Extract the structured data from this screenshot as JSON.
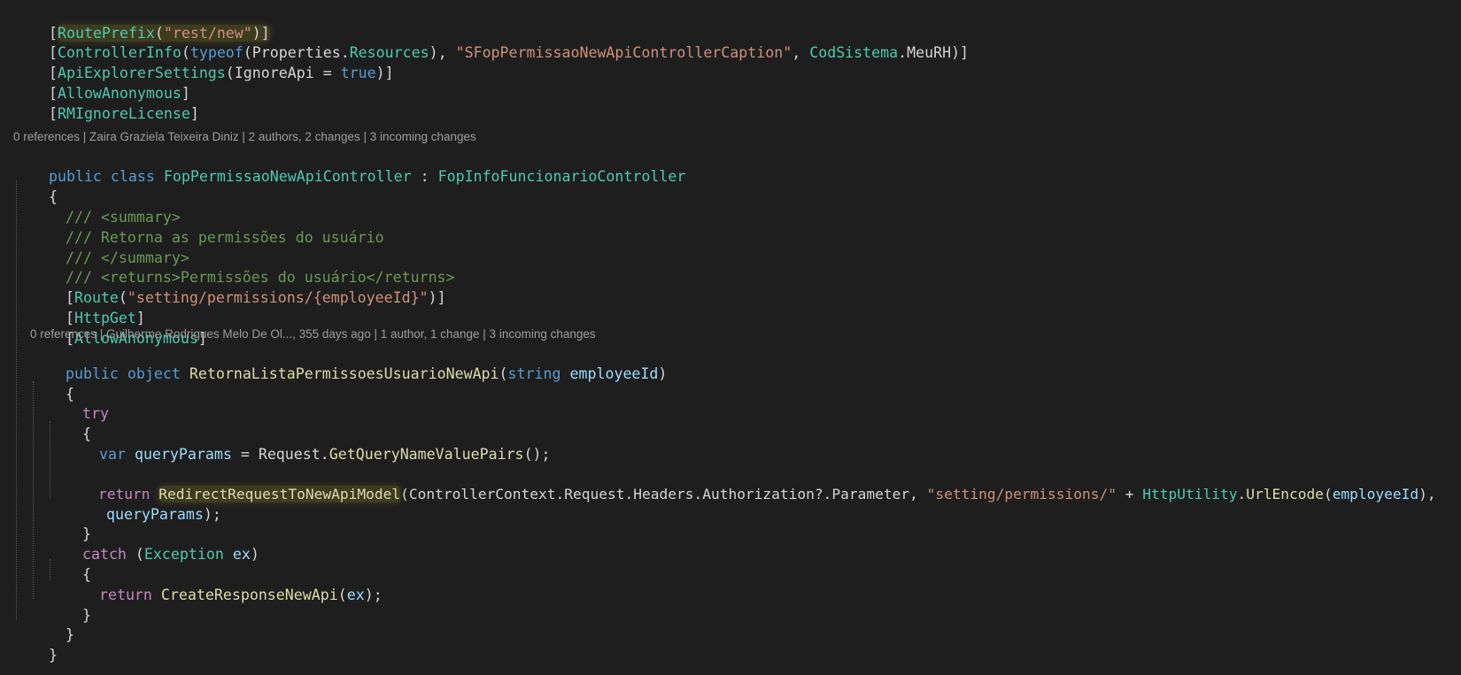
{
  "code": {
    "l1": {
      "a": "[",
      "b": "RoutePrefix",
      "c": "(",
      "d": "\"rest/new\"",
      "e": ")]"
    },
    "l2": {
      "a": "[",
      "b": "ControllerInfo",
      "c": "(",
      "d": "typeof",
      "e": "(Properties.",
      "f": "Resources",
      "g": "), ",
      "h": "\"SFopPermissaoNewApiControllerCaption\"",
      "i": ", ",
      "j": "CodSistema",
      "k": ".MeuRH)]"
    },
    "l3": {
      "a": "[",
      "b": "ApiExplorerSettings",
      "c": "(IgnoreApi = ",
      "d": "true",
      "e": ")]"
    },
    "l4": {
      "a": "[",
      "b": "AllowAnonymous",
      "c": "]"
    },
    "l5": {
      "a": "[",
      "b": "RMIgnoreLicense",
      "c": "]"
    },
    "l6": {
      "a": "public",
      "b": " ",
      "c": "class",
      "d": " ",
      "e": "FopPermissaoNewApiController",
      "f": " : ",
      "g": "FopInfoFuncionarioController"
    },
    "l7": {
      "a": "{"
    },
    "l8": {
      "a": "/// <summary>"
    },
    "l9": {
      "a": "/// Retorna as permissões do usuário"
    },
    "l10": {
      "a": "/// </summary>"
    },
    "l11": {
      "a": "/// <returns>Permissões do usuário</returns>"
    },
    "l12": {
      "a": "[",
      "b": "Route",
      "c": "(",
      "d": "\"setting/permissions/{employeeId}\"",
      "e": ")]"
    },
    "l13": {
      "a": "[",
      "b": "HttpGet",
      "c": "]"
    },
    "l14": {
      "a": "[",
      "b": "AllowAnonymous",
      "c": "]"
    },
    "l15": {
      "a": "public",
      "b": " ",
      "c": "object",
      "d": " ",
      "e": "RetornaListaPermissoesUsuarioNewApi",
      "f": "(",
      "g": "string",
      "h": " ",
      "i": "employeeId",
      "j": ")"
    },
    "l16": {
      "a": "{"
    },
    "l17": {
      "a": "try"
    },
    "l18": {
      "a": "{"
    },
    "l19": {
      "a": "var",
      "b": " ",
      "c": "queryParams",
      "d": " = Request.",
      "e": "GetQueryNameValuePairs",
      "f": "();"
    },
    "l20": {
      "a": "return",
      "b": " ",
      "c": "RedirectRequestToNewApiModel",
      "d": "(ControllerContext.Request.Headers.Authorization?.Parameter, ",
      "e": "\"setting/permissions/\"",
      "f": " + ",
      "g": "HttpUtility",
      "h": ".",
      "i": "UrlEncode",
      "j": "(",
      "k": "employeeId",
      "l": "),"
    },
    "l21": {
      "a": "queryParams",
      "b": ");"
    },
    "l22": {
      "a": "}"
    },
    "l23": {
      "a": "catch",
      "b": " (",
      "c": "Exception",
      "d": " ",
      "e": "ex",
      "f": ")"
    },
    "l24": {
      "a": "{"
    },
    "l25": {
      "a": "return",
      "b": " ",
      "c": "CreateResponseNewApi",
      "d": "(",
      "e": "ex",
      "f": ");"
    },
    "l26": {
      "a": "}"
    },
    "l27": {
      "a": "}"
    },
    "l28": {
      "a": "}"
    }
  },
  "codelens": {
    "class_lens": "0 references | Zaira Graziela Teixeira Diniz | 2 authors, 2 changes | 3 incoming changes",
    "method_lens": "0 references | Guilherme Rodrigues Melo De Ol..., 355 days ago | 1 author, 1 change | 3 incoming changes"
  },
  "colors": {
    "background": "#1e1e1e",
    "keyword": "#569cd6",
    "control_keyword": "#c586c0",
    "type": "#4ec9b0",
    "string": "#ce9178",
    "method": "#dcdcaa",
    "variable": "#9cdcfe",
    "comment": "#6a9955",
    "plain": "#d4d4d4",
    "codelens": "#9d9d9d",
    "highlight": "#d2c828"
  }
}
